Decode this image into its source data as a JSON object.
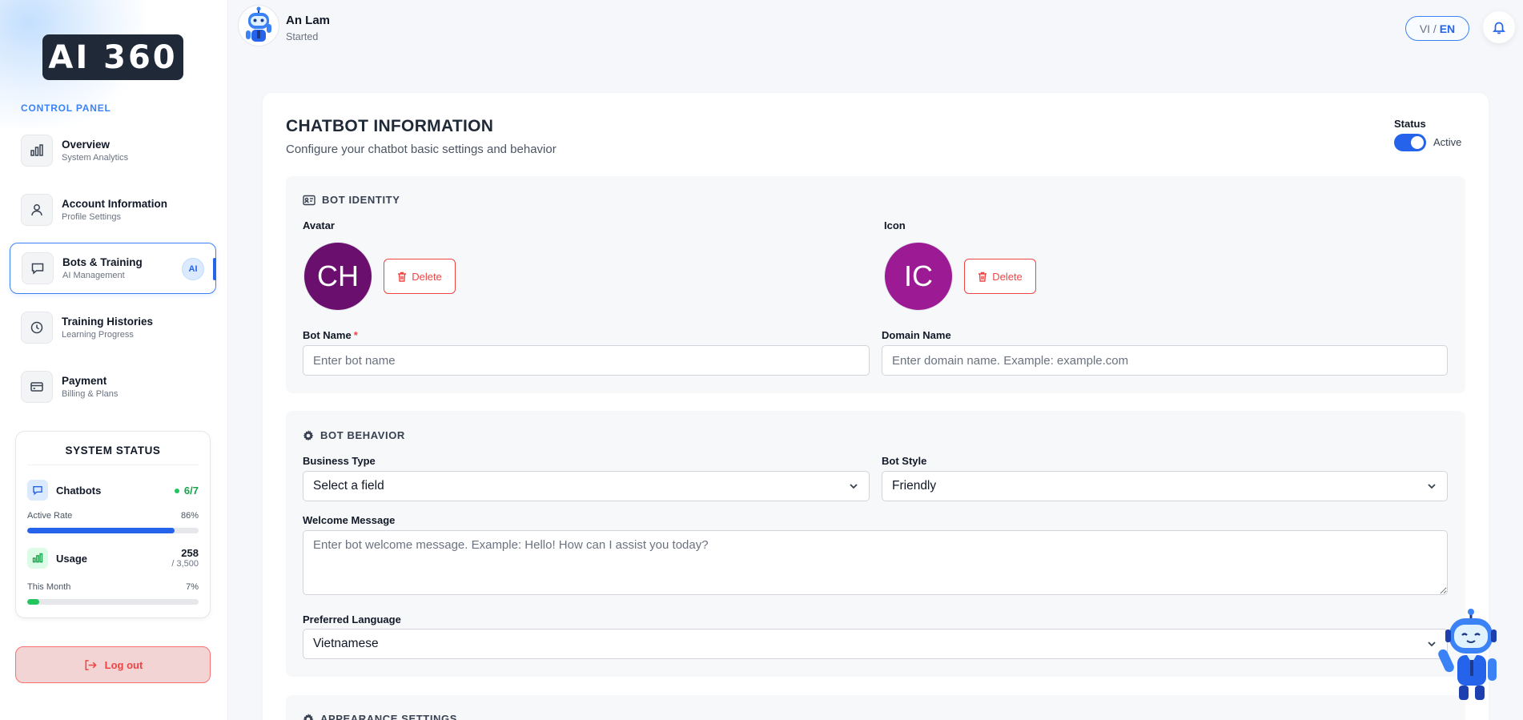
{
  "brand": {
    "logo_text": "AI 360"
  },
  "sidebar": {
    "section_label": "CONTROL PANEL",
    "items": [
      {
        "title": "Overview",
        "subtitle": "System Analytics",
        "icon": "bar-chart-icon"
      },
      {
        "title": "Account Information",
        "subtitle": "Profile Settings",
        "icon": "user-icon"
      },
      {
        "title": "Bots & Training",
        "subtitle": "AI Management",
        "icon": "chat-bubble-icon",
        "badge": "AI",
        "active": true
      },
      {
        "title": "Training Histories",
        "subtitle": "Learning Progress",
        "icon": "clock-icon"
      },
      {
        "title": "Payment",
        "subtitle": "Billing & Plans",
        "icon": "credit-card-icon"
      }
    ],
    "system_status": {
      "title": "SYSTEM STATUS",
      "chatbots": {
        "label": "Chatbots",
        "value": "6/7",
        "rate_label": "Active Rate",
        "rate_value": "86%",
        "rate_fraction": 0.86,
        "color": "#2563eb"
      },
      "usage": {
        "label": "Usage",
        "value": "258",
        "limit": "/ 3,500",
        "month_label": "This Month",
        "month_value": "7%",
        "month_fraction": 0.07,
        "color": "#22c55e"
      }
    },
    "logout_label": "Log out"
  },
  "header": {
    "user_name": "An Lam",
    "user_status": "Started",
    "lang_vi": "VI",
    "lang_sep": " / ",
    "lang_en": "EN"
  },
  "main": {
    "title": "CHATBOT INFORMATION",
    "subtitle": "Configure your chatbot basic settings and behavior",
    "status_label": "Status",
    "status_value": "Active",
    "identity": {
      "heading": "BOT IDENTITY",
      "avatar_label": "Avatar",
      "avatar_initials": "CH",
      "avatar_color": "#6b0f6f",
      "icon_label": "Icon",
      "icon_initials": "IC",
      "icon_color": "#9c1b94",
      "delete_label": "Delete",
      "bot_name_label": "Bot Name",
      "bot_name_required": "*",
      "bot_name_placeholder": "Enter bot name",
      "domain_label": "Domain Name",
      "domain_placeholder": "Enter domain name. Example: example.com"
    },
    "behavior": {
      "heading": "BOT BEHAVIOR",
      "business_type_label": "Business Type",
      "business_type_value": "Select a field",
      "bot_style_label": "Bot Style",
      "bot_style_value": "Friendly",
      "welcome_label": "Welcome Message",
      "welcome_placeholder": "Enter bot welcome message. Example: Hello! How can I assist you today?",
      "language_label": "Preferred Language",
      "language_value": "Vietnamese"
    },
    "appearance": {
      "heading": "APPEARANCE SETTINGS"
    }
  },
  "colors": {
    "accent": "#2563eb",
    "danger": "#ef4444",
    "success": "#22c55e"
  }
}
